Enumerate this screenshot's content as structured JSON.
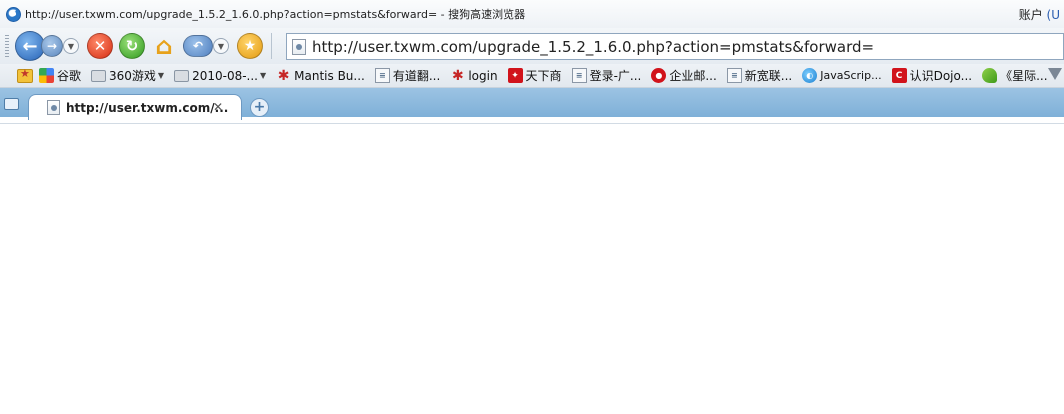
{
  "window": {
    "title": "http://user.txwm.com/upgrade_1.5.2_1.6.0.php?action=pmstats&forward= - 搜狗高速浏览器",
    "account_label": "账户",
    "account_suffix": "(U"
  },
  "address_bar": {
    "url": "http://user.txwm.com/upgrade_1.5.2_1.6.0.php?action=pmstats&forward="
  },
  "favorites": {
    "items": [
      {
        "label": "谷歌",
        "icon": "google-icon"
      },
      {
        "label": "360游戏",
        "icon": "folder-icon"
      },
      {
        "label": "2010-08-...",
        "icon": "folder-icon"
      },
      {
        "label": "Mantis Bu...",
        "icon": "bug-icon"
      },
      {
        "label": "有道翻...",
        "icon": "page-icon"
      },
      {
        "label": "login",
        "icon": "bug-icon"
      },
      {
        "label": "天下商",
        "icon": "red-logo-icon"
      },
      {
        "label": "登录-广...",
        "icon": "page-icon"
      },
      {
        "label": "企业邮...",
        "icon": "red-circle-icon"
      },
      {
        "label": "新宽联...",
        "icon": "page-icon"
      },
      {
        "label": "JavaScrip...",
        "icon": "blue-globe-icon"
      },
      {
        "label": "认识Dojo...",
        "icon": "red-c-icon"
      },
      {
        "label": "《星际...",
        "icon": "green-leaf-icon"
      }
    ]
  },
  "tabs": [
    {
      "title": "http://user.txwm.com/..."
    }
  ],
  "colors": {
    "tab_strip": "#8ab8dd",
    "address_border": "#8fa6be"
  }
}
